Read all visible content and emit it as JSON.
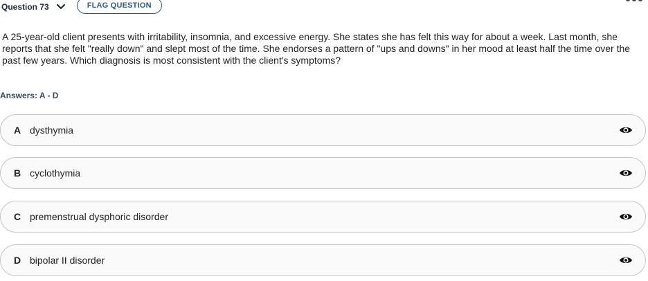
{
  "header": {
    "question_label": "Question 73",
    "flag_label": "FLAG QUESTION"
  },
  "question_text": "A 25-year-old client presents with irritability, insomnia, and excessive energy. She states she has felt this way for about a week. Last month, she reports that she felt \"really down\" and slept most of the time. She endorses a pattern of \"ups and downs\" in her mood at least half the time over the past few years. Which diagnosis is most consistent with the client's symptoms?",
  "answers_label": "Answers: A - D",
  "options": [
    {
      "letter": "A",
      "text": "dysthymia"
    },
    {
      "letter": "B",
      "text": "cyclothymia"
    },
    {
      "letter": "C",
      "text": "premenstrual dysphoric disorder"
    },
    {
      "letter": "D",
      "text": "bipolar II disorder"
    }
  ],
  "icons": {
    "question_toggle": "chevron-down-icon",
    "menu": "more-icon",
    "option_reveal": "eye-icon"
  }
}
